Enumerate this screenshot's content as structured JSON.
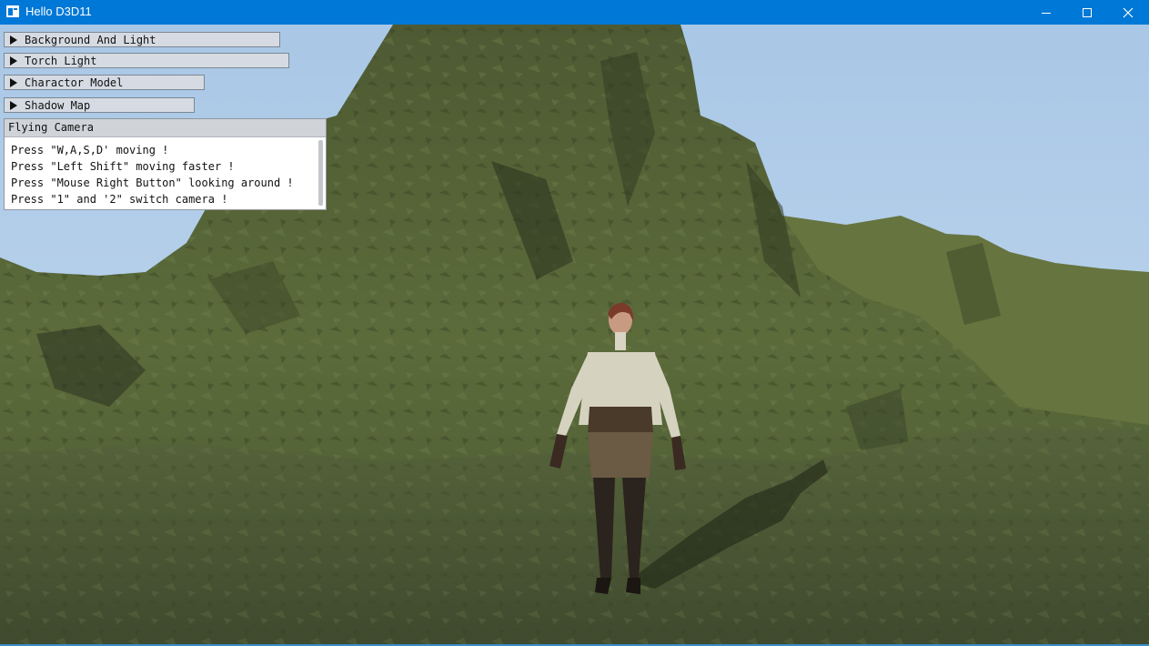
{
  "window": {
    "title": "Hello D3D11"
  },
  "panels": [
    {
      "label": "Background And Light"
    },
    {
      "label": "Torch Light"
    },
    {
      "label": "Charactor Model"
    },
    {
      "label": "Shadow Map"
    }
  ],
  "camera_panel": {
    "title": "Flying Camera",
    "lines": [
      "Press \"W,A,S,D' moving !",
      "Press \"Left Shift\" moving faster !",
      "Press \"Mouse Right Button\" looking around !",
      "Press \"1\" and '2\" switch camera !"
    ]
  },
  "colors": {
    "titlebar": "#0078d7",
    "sky": "#b9d3ec",
    "ground": "#4b5a34"
  }
}
